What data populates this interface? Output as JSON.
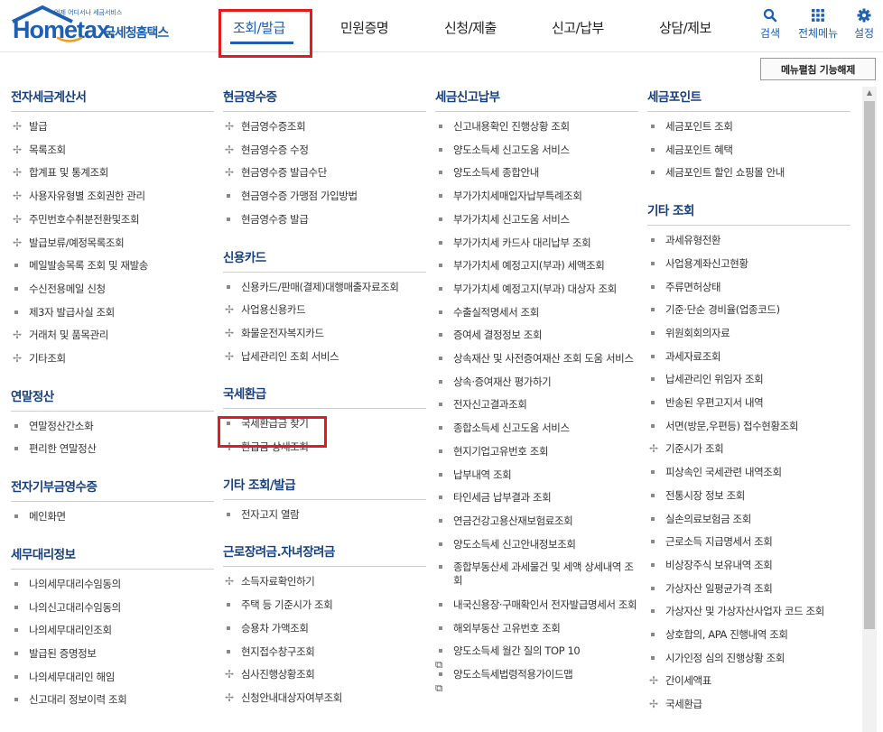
{
  "logo": {
    "wordmark": "Hometax.",
    "sub": "언제 어디서나 세금서비스",
    "kor": "국세청홈택스"
  },
  "gnb": [
    {
      "label": "조회/발급",
      "active": true
    },
    {
      "label": "민원증명"
    },
    {
      "label": "신청/제출"
    },
    {
      "label": "신고/납부"
    },
    {
      "label": "상담/제보"
    }
  ],
  "util": [
    {
      "label": "검색",
      "icon": "search-icon"
    },
    {
      "label": "전체메뉴",
      "icon": "grid-icon"
    },
    {
      "label": "설정",
      "icon": "gear-icon"
    }
  ],
  "menu_toggle_label": "메뉴펼침 기능해제",
  "accent_color": "#1d5fb0",
  "highlight_color": "#e21a22",
  "columns": [
    {
      "sections": [
        {
          "title": "전자세금계산서",
          "items": [
            {
              "label": "발급",
              "mark": "plus"
            },
            {
              "label": "목록조회",
              "mark": "plus"
            },
            {
              "label": "합계표 및 통계조회",
              "mark": "plus"
            },
            {
              "label": "사용자유형별 조회권한 관리",
              "mark": "plus"
            },
            {
              "label": "주민번호수취분전환및조회",
              "mark": "plus"
            },
            {
              "label": "발급보류/예정목록조회",
              "mark": "plus"
            },
            {
              "label": "메일발송목록 조회 및 재발송",
              "mark": "dot"
            },
            {
              "label": "수신전용메일 신청",
              "mark": "dot"
            },
            {
              "label": "제3자 발급사실 조회",
              "mark": "dot"
            },
            {
              "label": "거래처 및 품목관리",
              "mark": "plus"
            },
            {
              "label": "기타조회",
              "mark": "plus"
            }
          ]
        },
        {
          "title": "연말정산",
          "items": [
            {
              "label": "연말정산간소화",
              "mark": "dot"
            },
            {
              "label": "편리한 연말정산",
              "mark": "dot"
            }
          ]
        },
        {
          "title": "전자기부금영수증",
          "items": [
            {
              "label": "메인화면",
              "mark": "dot"
            }
          ]
        },
        {
          "title": "세무대리정보",
          "items": [
            {
              "label": "나의세무대리수임동의",
              "mark": "dot"
            },
            {
              "label": "나의신고대리수임동의",
              "mark": "dot"
            },
            {
              "label": "나의세무대리인조회",
              "mark": "dot"
            },
            {
              "label": "발급된 증명정보",
              "mark": "dot"
            },
            {
              "label": "나의세무대리인 해임",
              "mark": "dot"
            },
            {
              "label": "신고대리 정보이력 조회",
              "mark": "dot"
            }
          ]
        }
      ]
    },
    {
      "sections": [
        {
          "title": "현금영수증",
          "items": [
            {
              "label": "현금영수증조회",
              "mark": "plus"
            },
            {
              "label": "현금영수증 수정",
              "mark": "plus"
            },
            {
              "label": "현금영수증 발급수단",
              "mark": "plus"
            },
            {
              "label": "현금영수증 가맹점 가입방법",
              "mark": "dot"
            },
            {
              "label": "현금영수증 발급",
              "mark": "dot"
            }
          ]
        },
        {
          "title": "신용카드",
          "items": [
            {
              "label": "신용카드/판매(결제)대행매출자료조회",
              "mark": "dot"
            },
            {
              "label": "사업용신용카드",
              "mark": "plus"
            },
            {
              "label": "화물운전자복지카드",
              "mark": "plus"
            },
            {
              "label": "납세관리인 조회 서비스",
              "mark": "plus"
            }
          ]
        },
        {
          "title": "국세환급",
          "items": [
            {
              "label": "국세환급금 찾기",
              "mark": "dot",
              "highlight": true
            },
            {
              "label": "환급금 상세조회",
              "mark": "plus"
            }
          ]
        },
        {
          "title": "기타 조회/발급",
          "items": [
            {
              "label": "전자고지 열람",
              "mark": "dot"
            }
          ]
        },
        {
          "title": "근로장려금.자녀장려금",
          "items": [
            {
              "label": "소득자료확인하기",
              "mark": "plus"
            },
            {
              "label": "주택 등 기준시가 조회",
              "mark": "dot"
            },
            {
              "label": "승용차 가액조회",
              "mark": "dot"
            },
            {
              "label": "현지접수창구조회",
              "mark": "dot"
            },
            {
              "label": "심사진행상황조회",
              "mark": "plus"
            },
            {
              "label": "신청안내대상자여부조회",
              "mark": "plus"
            }
          ]
        }
      ]
    },
    {
      "sections": [
        {
          "title": "세금신고납부",
          "items": [
            {
              "label": "신고내용확인 진행상황 조회",
              "mark": "dot"
            },
            {
              "label": "양도소득세 신고도움 서비스",
              "mark": "dot"
            },
            {
              "label": "양도소득세 종합안내",
              "mark": "dot"
            },
            {
              "label": "부가가치세매입자납부특례조회",
              "mark": "dot"
            },
            {
              "label": "부가가치세 신고도움 서비스",
              "mark": "dot"
            },
            {
              "label": "부가가치세 카드사 대리납부 조회",
              "mark": "dot"
            },
            {
              "label": "부가가치세 예정고지(부과) 세액조회",
              "mark": "dot"
            },
            {
              "label": "부가가치세 예정고지(부과) 대상자 조회",
              "mark": "dot"
            },
            {
              "label": "수출실적명세서 조회",
              "mark": "dot"
            },
            {
              "label": "증여세 결정정보 조회",
              "mark": "dot"
            },
            {
              "label": "상속재산 및 사전증여재산 조회 도움 서비스",
              "mark": "dot"
            },
            {
              "label": "상속·증여재산 평가하기",
              "mark": "dot"
            },
            {
              "label": "전자신고결과조회",
              "mark": "dot"
            },
            {
              "label": "종합소득세 신고도움 서비스",
              "mark": "dot"
            },
            {
              "label": "현지기업고유번호 조회",
              "mark": "dot"
            },
            {
              "label": "납부내역 조회",
              "mark": "dot"
            },
            {
              "label": "타인세금 납부결과 조회",
              "mark": "dot"
            },
            {
              "label": "연금건강고용산재보험료조회",
              "mark": "dot"
            },
            {
              "label": "양도소득세 신고안내정보조회",
              "mark": "dot"
            },
            {
              "label": "종합부동산세 과세물건 및 세액 상세내역 조회",
              "mark": "dot"
            },
            {
              "label": "내국신용장·구매확인서 전자발급명세서 조회",
              "mark": "dot"
            },
            {
              "label": "해외부동산 고유번호 조회",
              "mark": "dot"
            },
            {
              "label": "양도소득세 월간 질의 TOP 10",
              "mark": "dot",
              "external": true
            },
            {
              "label": "양도소득세법령적용가이드맵",
              "mark": "dot",
              "external": true
            }
          ]
        }
      ]
    },
    {
      "sections": [
        {
          "title": "세금포인트",
          "items": [
            {
              "label": "세금포인트 조회",
              "mark": "dot"
            },
            {
              "label": "세금포인트 혜택",
              "mark": "dot"
            },
            {
              "label": "세금포인트 할인 쇼핑몰 안내",
              "mark": "dot"
            }
          ]
        },
        {
          "title": "기타 조회",
          "items": [
            {
              "label": "과세유형전환",
              "mark": "dot"
            },
            {
              "label": "사업용계좌신고현황",
              "mark": "dot"
            },
            {
              "label": "주류면허상태",
              "mark": "dot"
            },
            {
              "label": "기준·단순 경비율(업종코드)",
              "mark": "dot"
            },
            {
              "label": "위원회회의자료",
              "mark": "dot"
            },
            {
              "label": "과세자료조회",
              "mark": "dot"
            },
            {
              "label": "납세관리인 위임자 조회",
              "mark": "dot"
            },
            {
              "label": "반송된 우편고지서 내역",
              "mark": "dot"
            },
            {
              "label": "서면(방문,우편등) 접수현황조회",
              "mark": "dot"
            },
            {
              "label": "기준시가 조회",
              "mark": "plus"
            },
            {
              "label": "피상속인 국세관련 내역조회",
              "mark": "dot"
            },
            {
              "label": "전통시장 정보 조회",
              "mark": "dot"
            },
            {
              "label": "실손의료보험금 조회",
              "mark": "dot"
            },
            {
              "label": "근로소득 지급명세서 조회",
              "mark": "dot"
            },
            {
              "label": "비상장주식 보유내역 조회",
              "mark": "dot"
            },
            {
              "label": "가상자산 일평균가격 조회",
              "mark": "dot"
            },
            {
              "label": "가상자산 및 가상자산사업자 코드 조회",
              "mark": "dot"
            },
            {
              "label": "상호합의, APA 진행내역 조회",
              "mark": "dot"
            },
            {
              "label": "시가인정 심의 진행상황 조회",
              "mark": "dot"
            },
            {
              "label": "간이세액표",
              "mark": "plus"
            },
            {
              "label": "국세환급",
              "mark": "plus"
            }
          ]
        }
      ]
    }
  ]
}
